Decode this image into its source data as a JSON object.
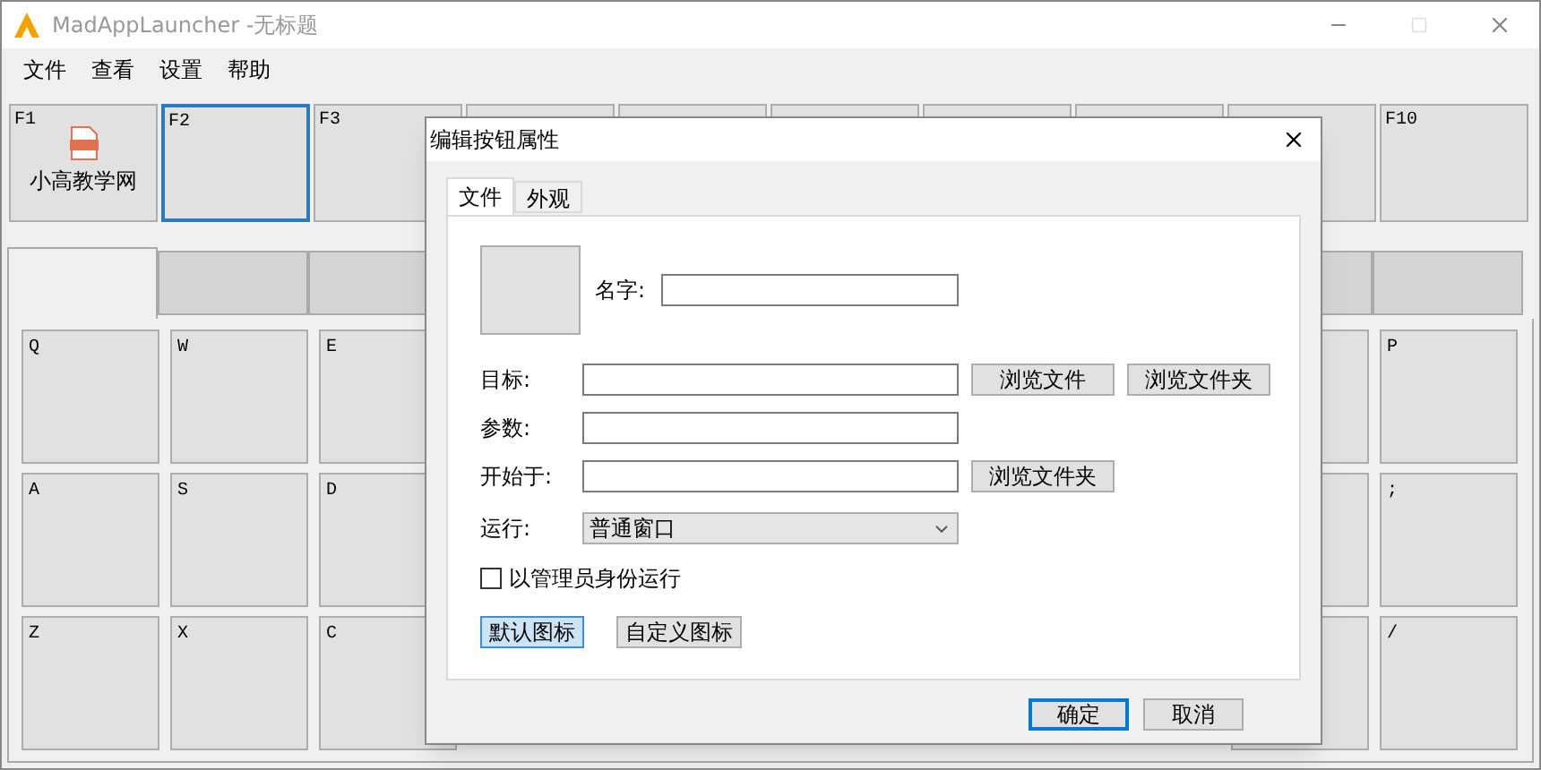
{
  "window": {
    "title": "MadAppLauncher -无标题"
  },
  "menu": [
    "文件",
    "查看",
    "设置",
    "帮助"
  ],
  "function_keys": [
    {
      "label": "F1",
      "app_name": "小高教学网",
      "kind": "file",
      "selected": false
    },
    {
      "label": "F2",
      "kind": "empty",
      "selected": true
    },
    {
      "label": "F3",
      "kind": "empty",
      "selected": false
    },
    {
      "kind": "empty",
      "selected": false
    },
    {
      "kind": "empty",
      "selected": false
    },
    {
      "kind": "empty",
      "selected": false
    },
    {
      "kind": "empty",
      "selected": false
    },
    {
      "kind": "empty",
      "selected": false
    },
    {
      "kind": "empty",
      "selected": false
    },
    {
      "label": "F10",
      "kind": "empty",
      "selected": false
    }
  ],
  "key_tabs": [
    {
      "selected": true
    },
    {
      "selected": false
    },
    {
      "selected": false
    },
    {
      "selected": false
    },
    {
      "selected": false
    }
  ],
  "key_rows": [
    [
      {
        "label": "Q"
      },
      {
        "label": "W"
      },
      {
        "label": "E"
      },
      {},
      {
        "label": "P"
      }
    ],
    [
      {
        "label": "A"
      },
      {
        "label": "S"
      },
      {
        "label": "D"
      },
      {},
      {
        "label": ";"
      }
    ],
    [
      {
        "label": "Z"
      },
      {
        "label": "X"
      },
      {
        "label": "C"
      },
      {},
      {
        "label": "/"
      }
    ]
  ],
  "dialog": {
    "title": "编辑按钮属性",
    "tabs": [
      {
        "label": "文件",
        "selected": true
      },
      {
        "label": "外观",
        "selected": false
      }
    ],
    "name_label": "名字:",
    "target": {
      "label": "目标:",
      "buttons": [
        "浏览文件",
        "浏览文件夹"
      ]
    },
    "arguments": {
      "label": "参数:"
    },
    "start_in": {
      "label": "开始于:",
      "button": "浏览文件夹"
    },
    "run": {
      "label": "运行:",
      "value": "普通窗口"
    },
    "run_as_admin": {
      "label": "以管理员身份运行",
      "checked": false
    },
    "icon_buttons": [
      {
        "label": "默认图标",
        "selected": true
      },
      {
        "label": "自定义图标",
        "selected": false
      }
    ],
    "ok": "确定",
    "cancel": "取消"
  }
}
